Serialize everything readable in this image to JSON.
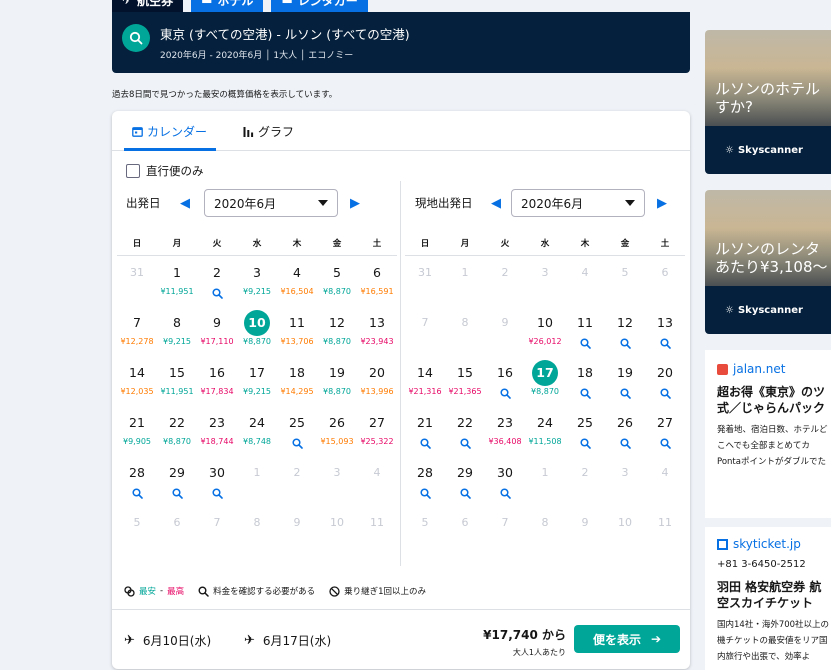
{
  "tabs": [
    "航空券",
    "ホテル",
    "レンタカー"
  ],
  "header": {
    "route": "東京 (すべての空港) - ルソン (すべての空港)",
    "details": "2020年6月 - 2020年6月 │ 1大人 │ エコノミー"
  },
  "notice": "過去8日間で見つかった最安の概算価格を表示しています。",
  "view_tabs": {
    "calendar": "カレンダー",
    "graph": "グラフ",
    "selected": "calendar"
  },
  "direct_only": {
    "label": "直行便のみ",
    "checked": false
  },
  "weekdays": [
    "日",
    "月",
    "火",
    "水",
    "木",
    "金",
    "土"
  ],
  "outbound": {
    "label": "出発日",
    "month": "2020年6月",
    "days": [
      {
        "d": "31",
        "m": true
      },
      {
        "d": "1",
        "p": "¥11,951",
        "c": "g"
      },
      {
        "d": "2",
        "q": true
      },
      {
        "d": "3",
        "p": "¥9,215",
        "c": "g"
      },
      {
        "d": "4",
        "p": "¥16,504",
        "c": "o"
      },
      {
        "d": "5",
        "p": "¥8,870",
        "c": "g"
      },
      {
        "d": "6",
        "p": "¥16,591",
        "c": "o"
      },
      {
        "d": "7",
        "p": "¥12,278",
        "c": "o"
      },
      {
        "d": "8",
        "p": "¥9,215",
        "c": "g"
      },
      {
        "d": "9",
        "p": "¥17,110",
        "c": "r"
      },
      {
        "d": "10",
        "p": "¥8,870",
        "c": "g",
        "s": true
      },
      {
        "d": "11",
        "p": "¥13,706",
        "c": "o"
      },
      {
        "d": "12",
        "p": "¥8,870",
        "c": "g"
      },
      {
        "d": "13",
        "p": "¥23,943",
        "c": "r"
      },
      {
        "d": "14",
        "p": "¥12,035",
        "c": "o"
      },
      {
        "d": "15",
        "p": "¥11,951",
        "c": "g"
      },
      {
        "d": "16",
        "p": "¥17,834",
        "c": "r"
      },
      {
        "d": "17",
        "p": "¥9,215",
        "c": "g"
      },
      {
        "d": "18",
        "p": "¥14,295",
        "c": "o"
      },
      {
        "d": "19",
        "p": "¥8,870",
        "c": "g"
      },
      {
        "d": "20",
        "p": "¥13,996",
        "c": "o"
      },
      {
        "d": "21",
        "p": "¥9,905",
        "c": "g"
      },
      {
        "d": "22",
        "p": "¥8,870",
        "c": "g"
      },
      {
        "d": "23",
        "p": "¥18,744",
        "c": "r"
      },
      {
        "d": "24",
        "p": "¥8,748",
        "c": "g"
      },
      {
        "d": "25",
        "q": true
      },
      {
        "d": "26",
        "p": "¥15,093",
        "c": "o"
      },
      {
        "d": "27",
        "p": "¥25,322",
        "c": "r"
      },
      {
        "d": "28",
        "q": true
      },
      {
        "d": "29",
        "q": true
      },
      {
        "d": "30",
        "q": true
      },
      {
        "d": "1",
        "m": true
      },
      {
        "d": "2",
        "m": true
      },
      {
        "d": "3",
        "m": true
      },
      {
        "d": "4",
        "m": true
      },
      {
        "d": "5",
        "m": true
      },
      {
        "d": "6",
        "m": true
      },
      {
        "d": "7",
        "m": true
      },
      {
        "d": "8",
        "m": true
      },
      {
        "d": "9",
        "m": true
      },
      {
        "d": "10",
        "m": true
      },
      {
        "d": "11",
        "m": true
      }
    ]
  },
  "inbound": {
    "label": "現地出発日",
    "month": "2020年6月",
    "days": [
      {
        "d": "31",
        "m": true
      },
      {
        "d": "1",
        "m": true
      },
      {
        "d": "2",
        "m": true
      },
      {
        "d": "3",
        "m": true
      },
      {
        "d": "4",
        "m": true
      },
      {
        "d": "5",
        "m": true
      },
      {
        "d": "6",
        "m": true
      },
      {
        "d": "7",
        "m": true
      },
      {
        "d": "8",
        "m": true
      },
      {
        "d": "9",
        "m": true
      },
      {
        "d": "10",
        "p": "¥26,012",
        "c": "r"
      },
      {
        "d": "11",
        "q": true
      },
      {
        "d": "12",
        "q": true
      },
      {
        "d": "13",
        "q": true
      },
      {
        "d": "14",
        "p": "¥21,316",
        "c": "r"
      },
      {
        "d": "15",
        "p": "¥21,365",
        "c": "r"
      },
      {
        "d": "16",
        "q": true
      },
      {
        "d": "17",
        "p": "¥8,870",
        "c": "g",
        "s": true
      },
      {
        "d": "18",
        "q": true
      },
      {
        "d": "19",
        "q": true
      },
      {
        "d": "20",
        "q": true
      },
      {
        "d": "21",
        "q": true
      },
      {
        "d": "22",
        "q": true
      },
      {
        "d": "23",
        "p": "¥36,408",
        "c": "r"
      },
      {
        "d": "24",
        "p": "¥11,508",
        "c": "g"
      },
      {
        "d": "25",
        "q": true
      },
      {
        "d": "26",
        "q": true
      },
      {
        "d": "27",
        "q": true
      },
      {
        "d": "28",
        "q": true
      },
      {
        "d": "29",
        "q": true
      },
      {
        "d": "30",
        "q": true
      },
      {
        "d": "1",
        "m": true
      },
      {
        "d": "2",
        "m": true
      },
      {
        "d": "3",
        "m": true
      },
      {
        "d": "4",
        "m": true
      },
      {
        "d": "5",
        "m": true
      },
      {
        "d": "6",
        "m": true
      },
      {
        "d": "7",
        "m": true
      },
      {
        "d": "8",
        "m": true
      },
      {
        "d": "9",
        "m": true
      },
      {
        "d": "10",
        "m": true
      },
      {
        "d": "11",
        "m": true
      }
    ]
  },
  "legend": {
    "cheapest": "最安",
    "sep": " - ",
    "highest": "最高",
    "check": "料金を確認する必要がある",
    "nonstop": "乗り継ぎ1回以上のみ"
  },
  "summary": {
    "depart": "6月10日(水)",
    "return": "6月17日(水)",
    "price": "¥17,740 から",
    "per": "大人1人あたり",
    "cta": "便を表示"
  },
  "ads": {
    "hotel_text": [
      "ルソンのホテル",
      "すか?"
    ],
    "car_text": [
      "ルソンのレンタ",
      "あたり¥3,108～"
    ],
    "skyscanner": "Skyscanner",
    "jalan": {
      "brand": "jalan.net",
      "title": "超お得《東京》のツ式／じゃらんパック",
      "body": "発着地、宿泊日数、ホテルどこへでも全部まとめてカPontaポイントがダブルでた"
    },
    "skyticket": {
      "brand": "skyticket.jp",
      "phone": "+81 3-6450-2512",
      "title": "羽田 格安航空券 航空スカイチケット",
      "body": "国内14社・海外700社以上の機チケットの最安値をリア国内旅行や出張で、効率よ"
    }
  },
  "colors": {
    "accent": "#0770e3",
    "header": "#05203c",
    "teal": "#00a698",
    "cheap": "#00a698",
    "mid": "#ff7b00",
    "high": "#e70866"
  }
}
